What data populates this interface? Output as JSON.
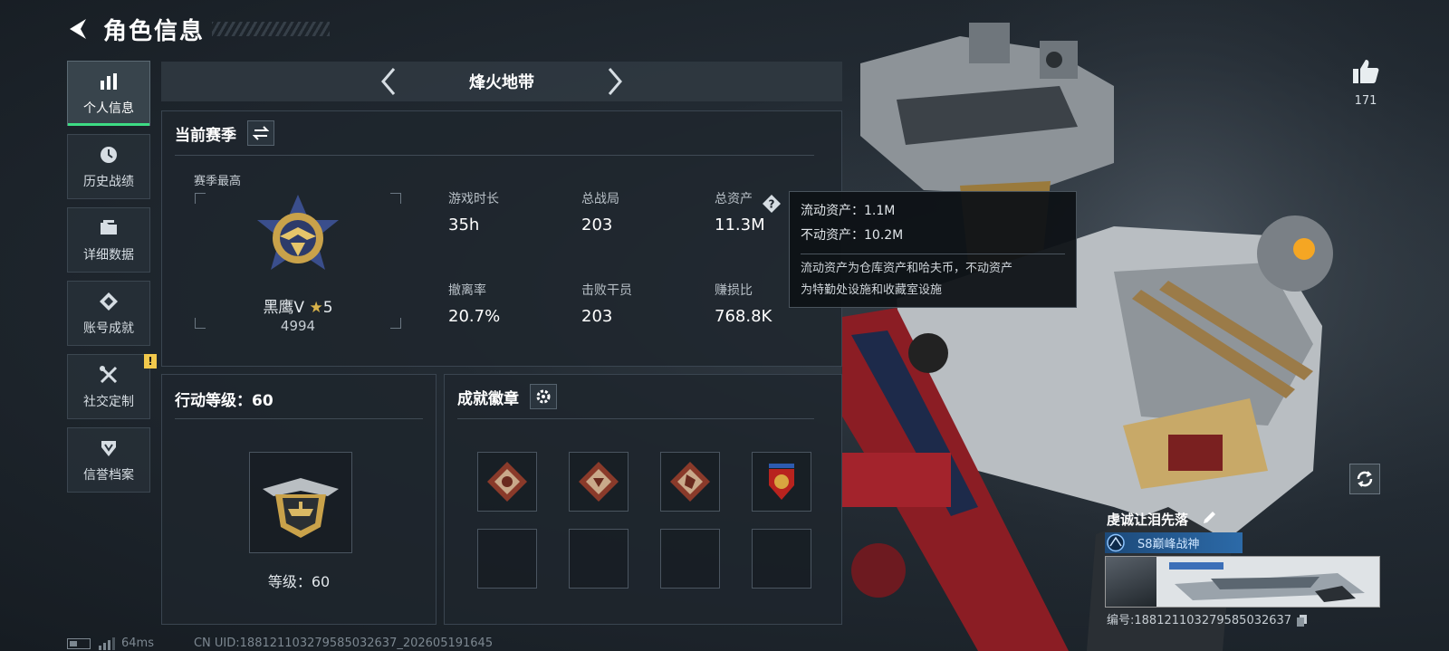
{
  "header": {
    "title": "角色信息"
  },
  "nav": {
    "items": [
      {
        "label": "个人信息",
        "icon": "bar-chart-icon",
        "active": true
      },
      {
        "label": "历史战绩",
        "icon": "clock-icon",
        "active": false
      },
      {
        "label": "详细数据",
        "icon": "folder-icon",
        "active": false
      },
      {
        "label": "账号成就",
        "icon": "achievement-icon",
        "active": false
      },
      {
        "label": "社交定制",
        "icon": "tools-icon",
        "active": false,
        "badge": "!"
      },
      {
        "label": "信誉档案",
        "icon": "shield-icon",
        "active": false
      }
    ]
  },
  "mode": {
    "title": "烽火地带"
  },
  "season": {
    "title": "当前赛季",
    "best_label": "赛季最高",
    "rank_name": "黑鹰V",
    "rank_star": "★",
    "rank_stars": "5",
    "rank_score": "4994",
    "stats": [
      {
        "label": "游戏时长",
        "value": "35h"
      },
      {
        "label": "总战局",
        "value": "203"
      },
      {
        "label": "总资产",
        "value": "11.3M"
      },
      {
        "label": "撤离率",
        "value": "20.7%"
      },
      {
        "label": "击败干员",
        "value": "203"
      },
      {
        "label": "赚损比",
        "value": "768.8K"
      }
    ]
  },
  "tooltip": {
    "liquid": "流动资产：1.1M",
    "fixed": "不动资产：10.2M",
    "desc_1": "流动资产为仓库资产和哈夫币，不动资产",
    "desc_2": "为特勤处设施和收藏室设施"
  },
  "level": {
    "title": "行动等级：60",
    "text": "等级：60"
  },
  "badges": {
    "title": "成就徽章"
  },
  "like": {
    "count": "171"
  },
  "card": {
    "name": "虔诚让泪先落",
    "title_badge": "S8巅峰战神",
    "id": "编号:18812110327958503263​7"
  },
  "footer": {
    "ping": "64ms",
    "uid": "CN UID:18812110327958503263​7_202605191645"
  },
  "colors": {
    "accent": "#3ddc84",
    "alert": "#f2c94c",
    "star": "#d8b24a"
  }
}
